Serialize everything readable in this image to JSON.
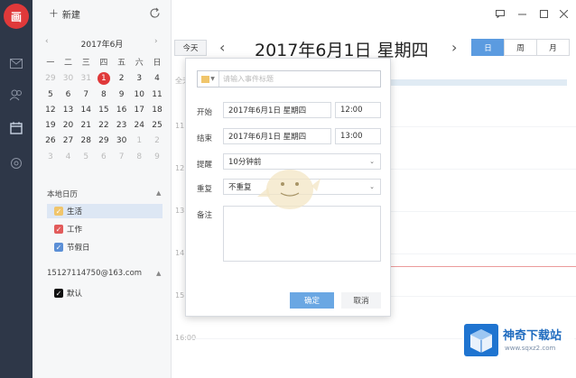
{
  "app": {
    "logo_text": "画",
    "new_label": "新建"
  },
  "window": {
    "buttons": [
      "☐",
      "—",
      "☐",
      "✕"
    ]
  },
  "mini_calendar": {
    "title": "2017年6月",
    "weekdays": [
      "一",
      "二",
      "三",
      "四",
      "五",
      "六",
      "日"
    ],
    "days": [
      {
        "n": "29",
        "dim": true
      },
      {
        "n": "30",
        "dim": true
      },
      {
        "n": "31",
        "dim": true
      },
      {
        "n": "1",
        "today": true
      },
      {
        "n": "2"
      },
      {
        "n": "3"
      },
      {
        "n": "4"
      },
      {
        "n": "5"
      },
      {
        "n": "6"
      },
      {
        "n": "7"
      },
      {
        "n": "8"
      },
      {
        "n": "9"
      },
      {
        "n": "10"
      },
      {
        "n": "11"
      },
      {
        "n": "12"
      },
      {
        "n": "13"
      },
      {
        "n": "14"
      },
      {
        "n": "15"
      },
      {
        "n": "16"
      },
      {
        "n": "17"
      },
      {
        "n": "18"
      },
      {
        "n": "19"
      },
      {
        "n": "20"
      },
      {
        "n": "21"
      },
      {
        "n": "22"
      },
      {
        "n": "23"
      },
      {
        "n": "24"
      },
      {
        "n": "25"
      },
      {
        "n": "26"
      },
      {
        "n": "27"
      },
      {
        "n": "28"
      },
      {
        "n": "29"
      },
      {
        "n": "30"
      },
      {
        "n": "1",
        "dim": true
      },
      {
        "n": "2",
        "dim": true
      },
      {
        "n": "3",
        "dim": true
      },
      {
        "n": "4",
        "dim": true
      },
      {
        "n": "5",
        "dim": true
      },
      {
        "n": "6",
        "dim": true
      },
      {
        "n": "7",
        "dim": true
      },
      {
        "n": "8",
        "dim": true
      },
      {
        "n": "9",
        "dim": true
      }
    ]
  },
  "sidebar": {
    "local_title": "本地日历",
    "local_items": [
      {
        "label": "生活",
        "color": "#f0c56b",
        "checked": true,
        "selected": true
      },
      {
        "label": "工作",
        "color": "#e25b5b",
        "checked": true
      },
      {
        "label": "节假日",
        "color": "#5b8fd6",
        "checked": true
      }
    ],
    "account_title": "15127114750@163.com",
    "account_items": [
      {
        "label": "默认",
        "color": "#111111",
        "checked": true
      }
    ]
  },
  "toolbar": {
    "today_label": "今天",
    "date_title": "2017年6月1日 星期四",
    "views": [
      "日",
      "周",
      "月"
    ],
    "active_view": "日"
  },
  "dayview": {
    "allday_label": "全天",
    "hours": [
      "11",
      "12",
      "13",
      "14",
      "15",
      "16:00"
    ],
    "now_label": "14"
  },
  "dialog": {
    "title_placeholder": "请输入事件标题",
    "start_label": "开始",
    "start_date": "2017年6月1日 星期四",
    "start_time": "12:00",
    "end_label": "结束",
    "end_date": "2017年6月1日 星期四",
    "end_time": "13:00",
    "reminder_label": "提醒",
    "reminder_value": "10分钟前",
    "repeat_label": "重复",
    "repeat_value": "不重复",
    "note_label": "备注",
    "ok_label": "确定",
    "cancel_label": "取消"
  },
  "watermark": {
    "name": "神奇下载站",
    "url": "www.sqxz2.com"
  },
  "colors": {
    "accent": "#5b9be0",
    "today": "#e0393a",
    "rail": "#2e3748"
  }
}
